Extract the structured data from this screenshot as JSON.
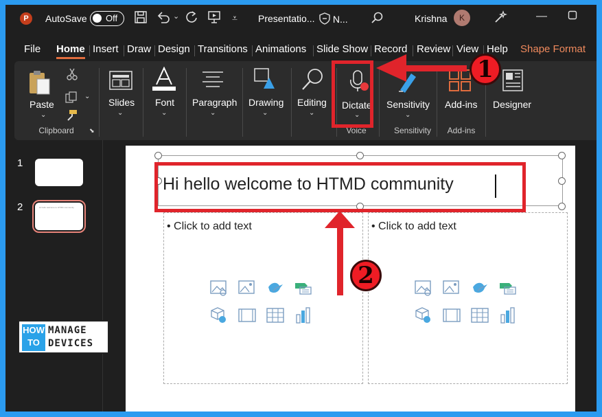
{
  "titlebar": {
    "autosave_label": "AutoSave",
    "autosave_state": "Off",
    "doc_title": "Presentatio...",
    "sensitivity_label": "N...",
    "user_name": "Krishna",
    "user_initial": "K",
    "app_initial": "P"
  },
  "menu": {
    "tabs": [
      "File",
      "Home",
      "Insert",
      "Draw",
      "Design",
      "Transitions",
      "Animations",
      "Slide Show",
      "Record",
      "Review",
      "View",
      "Help"
    ],
    "contextual_tab": "Shape Format",
    "active_tab": "Home"
  },
  "ribbon": {
    "paste": "Paste",
    "clipboard_group": "Clipboard",
    "slides": "Slides",
    "font": "Font",
    "paragraph": "Paragraph",
    "drawing": "Drawing",
    "editing": "Editing",
    "dictate": "Dictate",
    "voice_group": "Voice",
    "sensitivity": "Sensitivity",
    "sensitivity_group": "Sensitivity",
    "addins": "Add-ins",
    "addins_group": "Add-ins",
    "designer": "Designer"
  },
  "thumbnails": [
    {
      "number": "1"
    },
    {
      "number": "2",
      "mini_text": "Hi hello welcome to HTMD community"
    }
  ],
  "slide": {
    "title_text": "Hi hello welcome to HTMD community",
    "left_body": "• Click to add text",
    "right_body": "• Click to add text"
  },
  "annotations": {
    "badge1": "1",
    "badge2": "2",
    "color": "#e0242b"
  },
  "logo": {
    "left_lines": [
      "HOW",
      "TO"
    ],
    "right_lines": [
      "MANAGE",
      "DEVICES"
    ]
  },
  "colors": {
    "accent": "#e06c3e",
    "contextual": "#f08a5d",
    "frame": "#2b9bf0"
  }
}
